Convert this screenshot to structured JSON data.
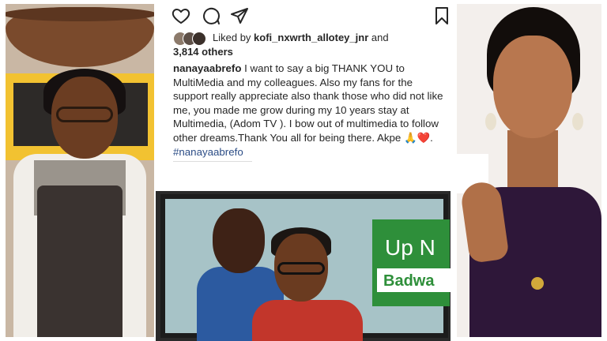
{
  "instagram": {
    "liked_prefix": "Liked by ",
    "liked_user": "kofi_nxwrth_allotey_jnr",
    "liked_suffix": " and",
    "others": "3,814 others",
    "caption_user": "nanayaabrefo",
    "caption_text": " I want to say a big THANK YOU to MultiMedia and my colleagues. Also my fans for the support really appreciate also thank those who did not like me, you made me grow during my 10 years stay at Multimedia, (Adom TV ). I bow out of multimedia to follow other dreams.Thank You all for being there. Akpe 🙏❤️. ",
    "caption_hashtag": "#nanayaabrefo",
    "icons": [
      "heart-icon",
      "comment-icon",
      "share-icon",
      "bookmark-icon"
    ]
  },
  "middle_photo": {
    "card_title": "Up N",
    "card_subtitle": "Badwa"
  },
  "colors": {
    "hashtag": "#2c4d86",
    "green_card": "#2e8f3a"
  }
}
